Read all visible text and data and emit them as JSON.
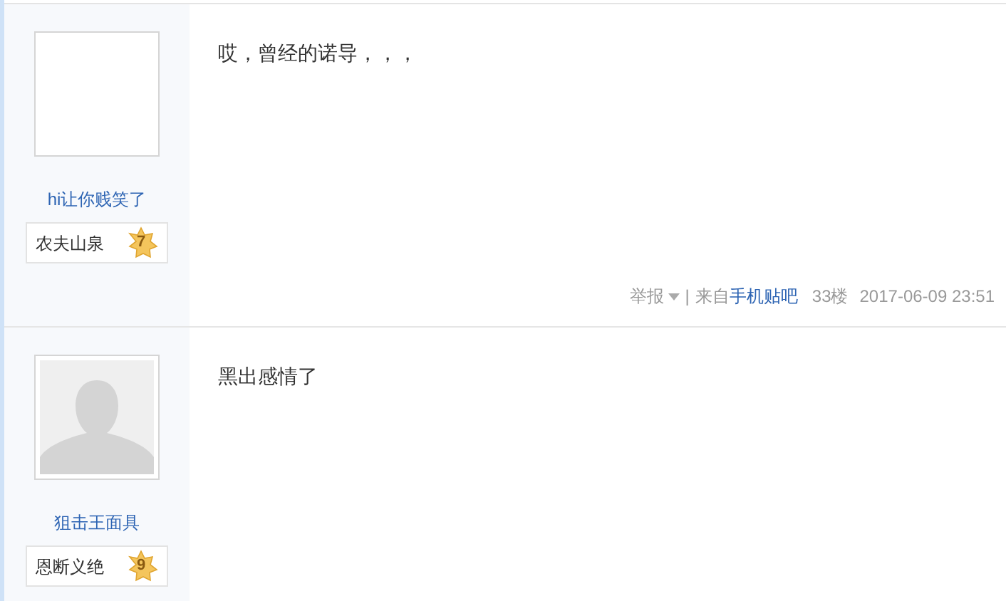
{
  "posts": [
    {
      "avatar": {
        "kind": "blank"
      },
      "username": "hi让你贱笑了",
      "badge": {
        "title": "农夫山泉",
        "level_number": "7"
      },
      "content": "哎，曾经的诺导，，，",
      "footer": {
        "report": "举报",
        "separator": "|",
        "source_prefix": "来自",
        "source_link": "手机贴吧",
        "floor": "33楼",
        "time": "2017-06-09 23:51"
      }
    },
    {
      "avatar": {
        "kind": "silhouette"
      },
      "username": "狙击王面具",
      "badge": {
        "title": "恩断义绝",
        "level_number": "9"
      },
      "content": "黑出感情了"
    }
  ]
}
